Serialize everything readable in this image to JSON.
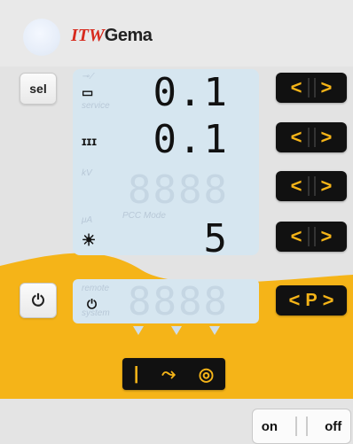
{
  "header": {
    "brand_prefix": "ITW",
    "brand_name": "Gema"
  },
  "buttons": {
    "sel_label": "sel",
    "power_symbol": "⏻",
    "arrow_left": "<",
    "arrow_right": ">",
    "program_label": "P",
    "on_label": "on",
    "off_label": "off"
  },
  "display": {
    "rows": [
      {
        "value": "0.1",
        "indicator": "▭"
      },
      {
        "value": "0.1",
        "indicator": "ɪɪɪ"
      },
      {
        "value": "",
        "indicator": ""
      },
      {
        "value": "5",
        "indicator": "☀"
      }
    ],
    "lower_label_1": "remote",
    "lower_label_2": "system",
    "row1_label": "service",
    "row3_label": "kV",
    "row4_label": "μA",
    "pcc_label": "PCC Mode"
  },
  "switch": {
    "left": "|",
    "middle": "⤳",
    "right": "◎"
  },
  "colors": {
    "accent": "#f5b418",
    "panel_dark": "#111111",
    "display_bg": "#d6e6f0"
  }
}
